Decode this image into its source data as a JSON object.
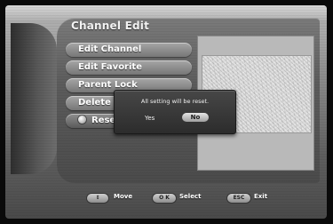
{
  "screen": {
    "title": "Channel Edit"
  },
  "menu": {
    "items": [
      {
        "label": "Edit Channel"
      },
      {
        "label": "Edit Favorite"
      },
      {
        "label": "Parent Lock"
      },
      {
        "label": "Delete"
      },
      {
        "label": "Reset"
      }
    ]
  },
  "dialog": {
    "message": "All setting will be reset.",
    "yes_label": "Yes",
    "no_label": "No"
  },
  "footer": {
    "move_key": "⇕",
    "move_label": "Move",
    "select_key": "O K",
    "select_label": "Select",
    "exit_key": "ESC",
    "exit_label": "Exit"
  }
}
